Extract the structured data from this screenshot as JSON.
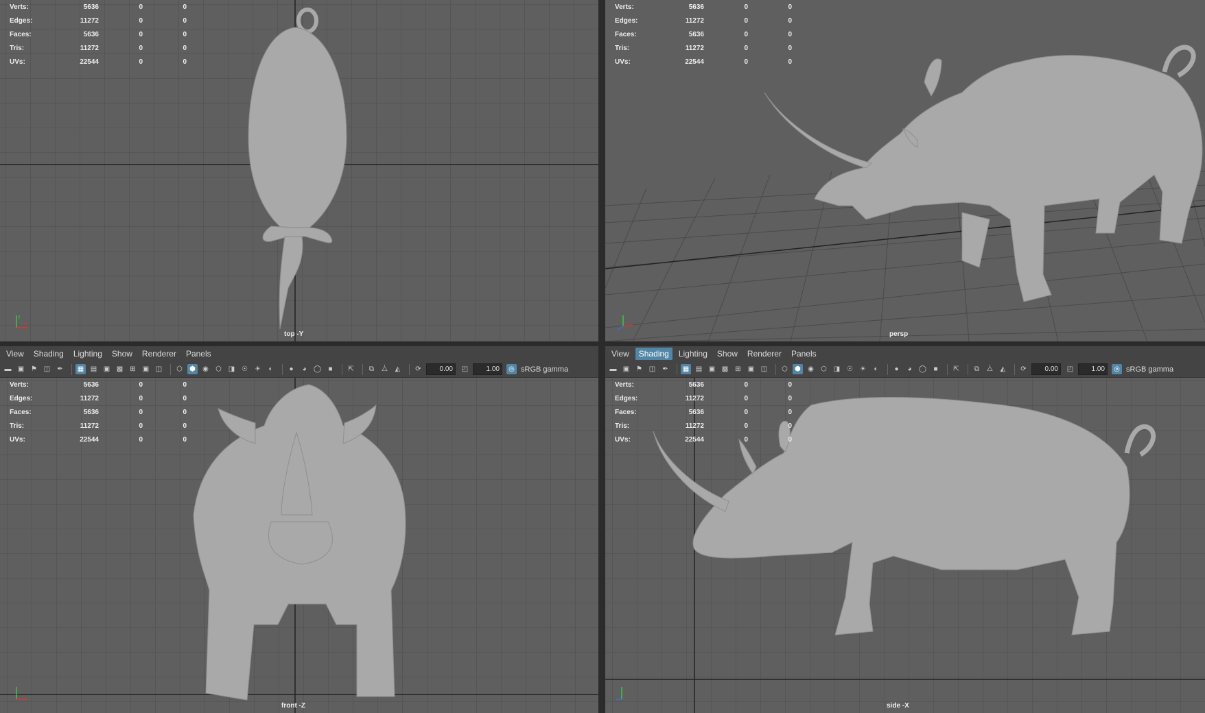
{
  "hud": {
    "rows": [
      {
        "label": "Verts:",
        "value": "5636",
        "c2": "0",
        "c3": "0"
      },
      {
        "label": "Edges:",
        "value": "11272",
        "c2": "0",
        "c3": "0"
      },
      {
        "label": "Faces:",
        "value": "5636",
        "c2": "0",
        "c3": "0"
      },
      {
        "label": "Tris:",
        "value": "11272",
        "c2": "0",
        "c3": "0"
      },
      {
        "label": "UVs:",
        "value": "22544",
        "c2": "0",
        "c3": "0"
      }
    ]
  },
  "menu": {
    "view": "View",
    "shading": "Shading",
    "lighting": "Lighting",
    "show": "Show",
    "renderer": "Renderer",
    "panels": "Panels"
  },
  "toolbar": {
    "exposure": "0.00",
    "gamma": "1.00",
    "colorspace": "sRGB gamma"
  },
  "panes": {
    "top_label": "top -Y",
    "persp_label": "persp",
    "front_label": "front -Z",
    "side_label": "side -X"
  },
  "colors": {
    "viewport_bg": "#5f5f5f",
    "menubar_bg": "#444444",
    "highlight": "#5285a6",
    "model": "#a8a8a8"
  }
}
